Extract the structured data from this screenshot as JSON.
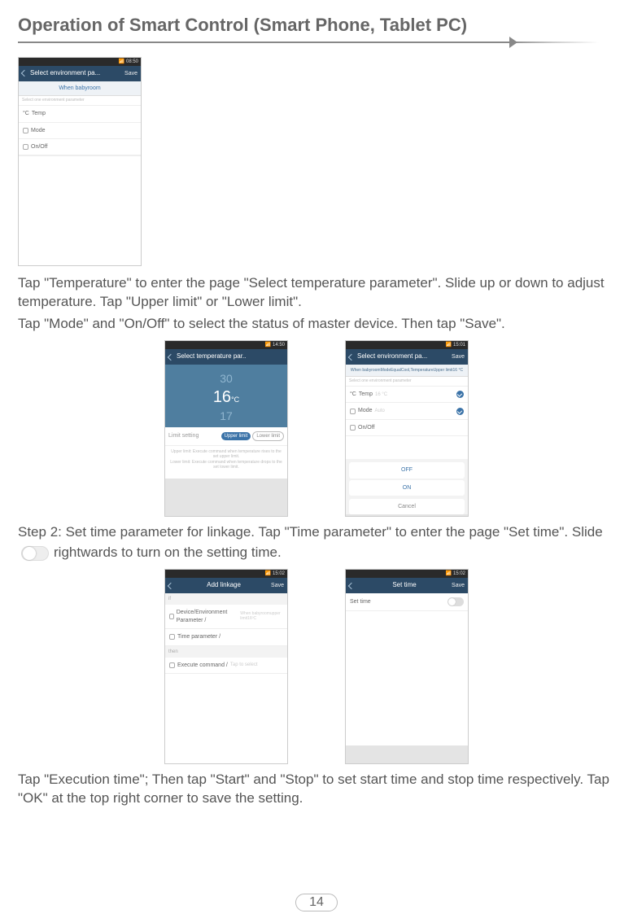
{
  "header": {
    "title": "Operation of Smart Control (Smart Phone, Tablet PC)"
  },
  "para1": "Tap \"Temperature\" to enter the page \"Select temperature parameter\". Slide up or down to adjust temperature. Tap \"Upper limit\" or \"Lower limit\".",
  "para1b": "Tap \"Mode\" and \"On/Off\" to select the status of master device. Then tap \"Save\".",
  "step2a": "Step 2: Set time parameter for linkage. Tap \"Time parameter\" to enter the page \"Set time\". Slide",
  "step2b": "rightwards to turn on the setting time.",
  "para3": "Tap \"Execution time\"; Then tap \"Start\" and \"Stop\" to set start time and stop time respectively. Tap \"OK\" at the top right corner to save the setting.",
  "page_number": "14",
  "phone1": {
    "time": "08:50",
    "title": "Select environment pa...",
    "save": "Save",
    "sub": "When babyroom",
    "cap": "Select one environment parameter",
    "items": [
      "Temp",
      "Mode",
      "On/Off"
    ],
    "tempPrefix": "°C"
  },
  "phone2": {
    "time": "14:50",
    "title": "Select temperature par..",
    "nums": [
      "30",
      "16",
      "17"
    ],
    "unit": "°C",
    "limit_label": "Limit setting",
    "upper": "Upper limit",
    "lower": "Lower limit",
    "desc": "Upper limit: Execute command when temperature rises to the set upper limit.\nLower limit: Execute command when temperature drops to the set lower limit."
  },
  "phone3": {
    "time": "15:01",
    "title": "Select environment pa...",
    "save": "Save",
    "sub": "When babyroomModeEqualCool,TemperatureUpper limit16 °C",
    "cap": "Select one environment parameter",
    "temp": "Temp",
    "temp_val": "16 °C",
    "mode": "Mode",
    "mode_val": "Auto",
    "onoff": "On/Off",
    "sheet": [
      "OFF",
      "ON",
      "Cancel"
    ]
  },
  "phone4": {
    "time": "15:02",
    "title": "Add linkage",
    "save": "Save",
    "if": "if",
    "dev": "Device/Environment Parameter /",
    "dev_sub": "When babyroomupper limit16ºC",
    "timep": "Time parameter /",
    "then": "then",
    "exec": "Execute command /",
    "exec_sub": "Tap to select"
  },
  "phone5": {
    "time": "15:02",
    "title": "Set time",
    "save": "Save",
    "row": "Set time"
  }
}
